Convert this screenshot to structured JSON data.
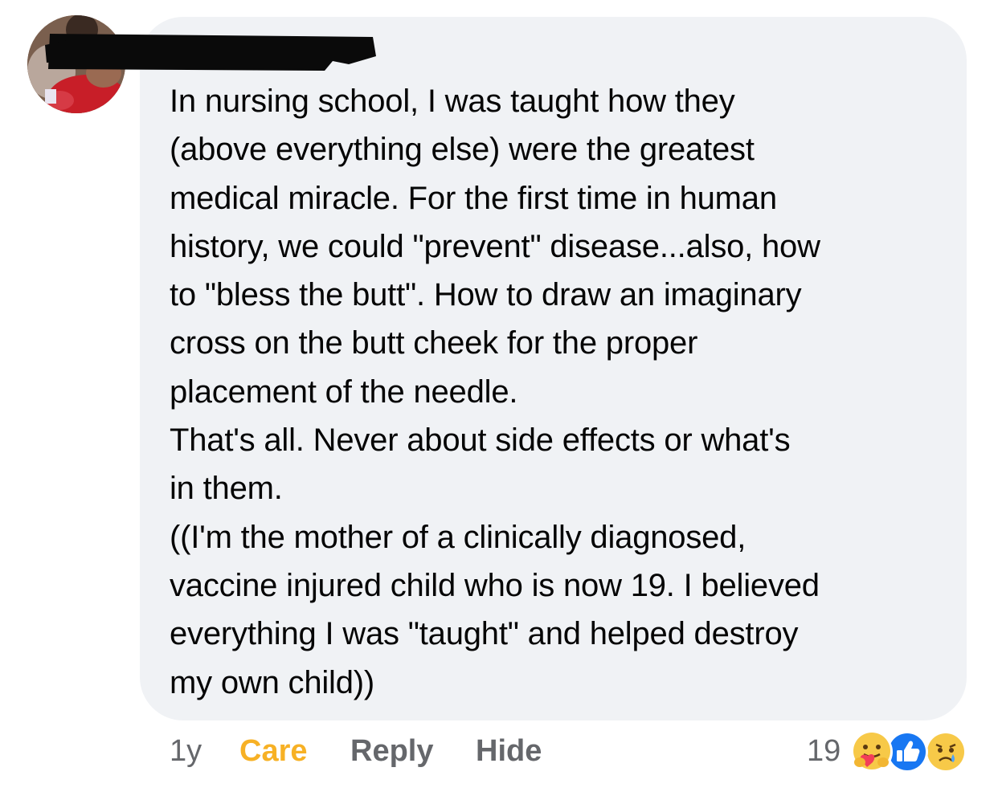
{
  "comment": {
    "text": "In nursing school, I was taught how they\n(above everything else) were the greatest\nmedical miracle. For the first time in human\nhistory, we could \"prevent\" disease...also, how\nto \"bless the butt\". How to draw an imaginary\ncross on the butt cheek for the proper\nplacement of the needle.\nThat's all. Never about side effects or what's\nin them.\n((I'm the mother of a clinically diagnosed,\nvaccine injured child who is now 19. I believed\neverything I was \"taught\" and helped destroy\nmy own child))"
  },
  "actions": {
    "time": "1y",
    "reaction": "Care",
    "reply": "Reply",
    "hide": "Hide"
  },
  "reactions": {
    "count": "19",
    "icons": [
      "care-icon",
      "like-icon",
      "sad-icon"
    ]
  },
  "colors": {
    "bubble": "#f0f2f5",
    "text": "#050505",
    "secondary_text": "#65676b",
    "care": "#f7b125",
    "like": "#1877f2"
  }
}
